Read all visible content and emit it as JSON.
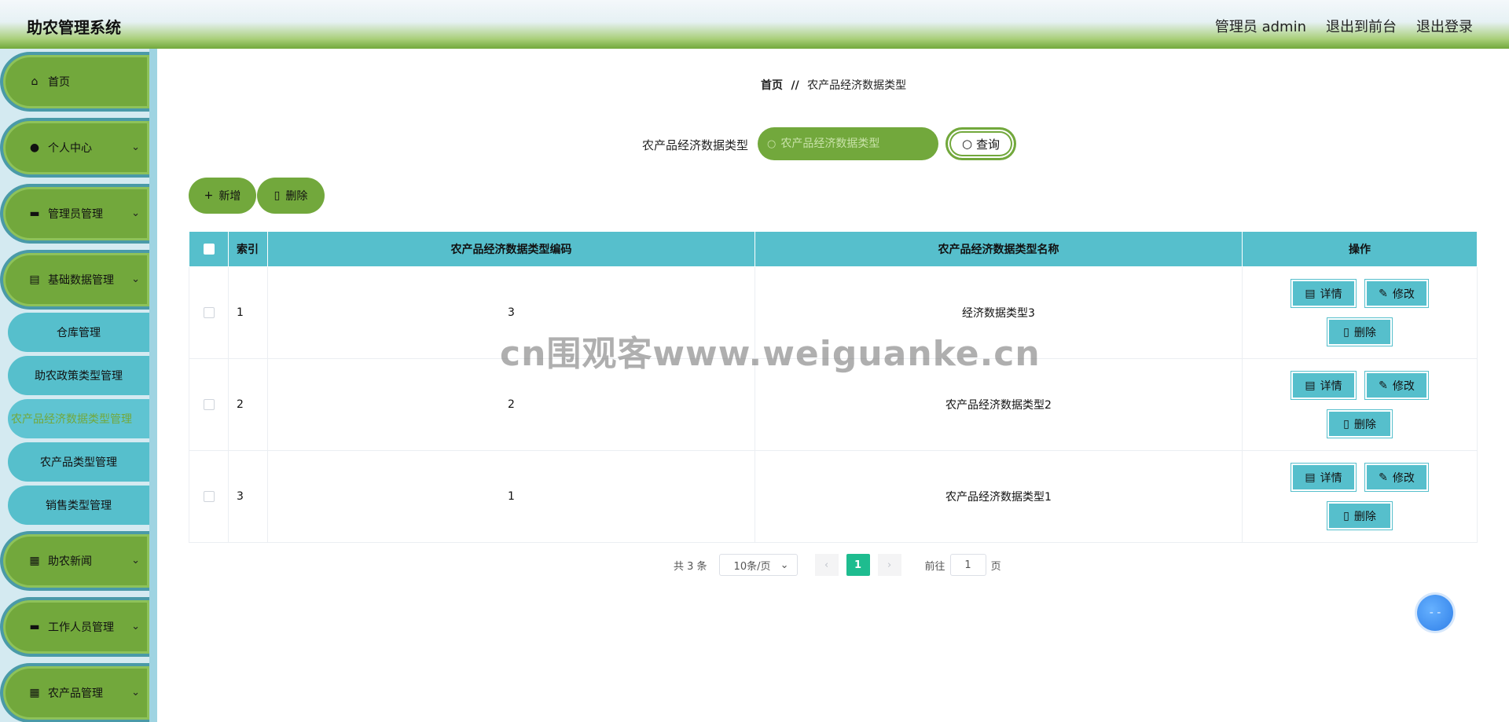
{
  "header": {
    "title": "助农管理系统",
    "admin_label": "管理员 admin",
    "front_label": "退出到前台",
    "logout_label": "退出登录"
  },
  "sidebar": {
    "items": [
      {
        "label": "首页",
        "icon": "home-icon"
      },
      {
        "label": "个人中心",
        "icon": "user-icon"
      },
      {
        "label": "管理员管理",
        "icon": "monitor-icon"
      },
      {
        "label": "基础数据管理",
        "icon": "clipboard-icon"
      },
      {
        "label": "助农新闻",
        "icon": "grid-icon"
      },
      {
        "label": "工作人员管理",
        "icon": "monitor-icon"
      },
      {
        "label": "农产品管理",
        "icon": "grid-icon"
      }
    ],
    "sub_items": [
      {
        "label": "仓库管理"
      },
      {
        "label": "助农政策类型管理"
      },
      {
        "label": "农产品经济数据类型管理"
      },
      {
        "label": "农产品类型管理"
      },
      {
        "label": "销售类型管理"
      }
    ],
    "active_color": "#72a83c"
  },
  "breadcrumb": {
    "home": "首页",
    "separator": "//",
    "current": "农产品经济数据类型"
  },
  "search": {
    "label": "农产品经济数据类型",
    "placeholder": "农产品经济数据类型",
    "value": "",
    "button_label": "查询"
  },
  "actions": {
    "add_label": "新增",
    "delete_label": "删除"
  },
  "table": {
    "headers": [
      "索引",
      "农产品经济数据类型编码",
      "农产品经济数据类型名称",
      "操作"
    ],
    "rows": [
      {
        "index": "1",
        "code": "3",
        "name": "经济数据类型3"
      },
      {
        "index": "2",
        "code": "2",
        "name": "农产品经济数据类型2"
      },
      {
        "index": "3",
        "code": "1",
        "name": "农产品经济数据类型1"
      }
    ],
    "op_labels": {
      "detail": "详情",
      "edit": "修改",
      "delete": "删除"
    }
  },
  "pagination": {
    "total": "共 3 条",
    "page_size": "10条/页",
    "current_page": "1",
    "goto_label": "前往",
    "goto_value": "1",
    "page_unit": "页"
  },
  "watermark": "cn围观客www.weiguanke.cn",
  "colors": {
    "green": "#72a83c",
    "teal": "#56bfcc",
    "page_active": "#1ebc8f"
  }
}
